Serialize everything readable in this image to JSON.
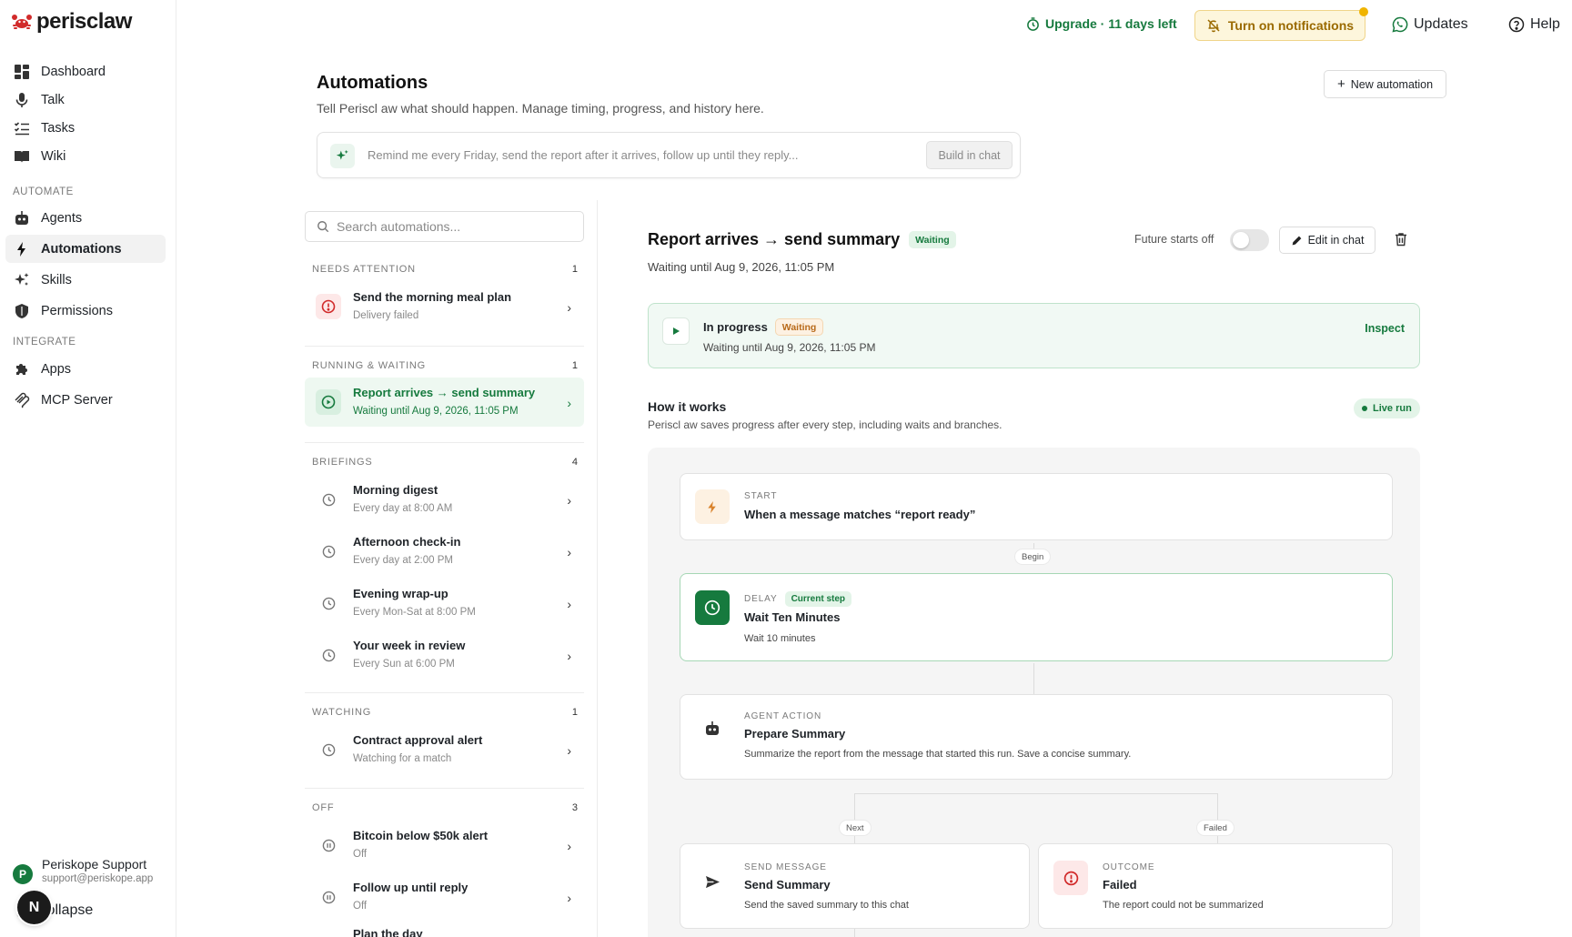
{
  "app": {
    "name": "periscl",
    "name_accent": "aw"
  },
  "colors": {
    "brand": "#167a3e",
    "warning": "#9a6a00",
    "danger": "#d12a2a"
  },
  "sidebar": {
    "nav": [
      {
        "label": "Dashboard",
        "icon": "dashboard-icon"
      },
      {
        "label": "Talk",
        "icon": "microphone-icon"
      },
      {
        "label": "Tasks",
        "icon": "checklist-icon"
      },
      {
        "label": "Wiki",
        "icon": "book-icon"
      }
    ],
    "section_automate": "AUTOMATE",
    "automate": [
      {
        "label": "Agents",
        "icon": "robot-icon"
      },
      {
        "label": "Automations",
        "icon": "bolt-icon",
        "active": true
      },
      {
        "label": "Skills",
        "icon": "sparkles-icon"
      },
      {
        "label": "Permissions",
        "icon": "shield-icon"
      }
    ],
    "section_integrate": "INTEGRATE",
    "integrate": [
      {
        "label": "Apps",
        "icon": "puzzle-icon"
      },
      {
        "label": "MCP Server",
        "icon": "mcp-icon"
      }
    ],
    "user": {
      "initial": "P",
      "name": "Periskope Support",
      "email": "support@periskope.app"
    },
    "collapse_label": "Collapse",
    "floating_badge": "N"
  },
  "topbar": {
    "upgrade": "Upgrade · 11 days left",
    "notifications": "Turn on notifications",
    "updates": "Updates",
    "help": "Help"
  },
  "header": {
    "title": "Automations",
    "subtitle": "Tell Periscl aw what should happen. Manage timing, progress, and history here.",
    "new_button": "New automation",
    "prompt_placeholder": "Remind me every Friday, send the report after it arrives, follow up until they reply...",
    "prompt_button": "Build in chat"
  },
  "list": {
    "search_placeholder": "Search automations...",
    "groups": {
      "attention": {
        "label": "NEEDS ATTENTION",
        "count": "1"
      },
      "running": {
        "label": "RUNNING & WAITING",
        "count": "1"
      },
      "briefings": {
        "label": "BRIEFINGS",
        "count": "4"
      },
      "watching": {
        "label": "WATCHING",
        "count": "1"
      },
      "off": {
        "label": "OFF",
        "count": "3"
      }
    },
    "rows": {
      "meal_plan": {
        "title": "Send the morning meal plan",
        "sub": "Delivery failed"
      },
      "report": {
        "title": "Report arrives → send summary",
        "sub": "Waiting until Aug 9, 2026, 11:05 PM"
      },
      "morning": {
        "title": "Morning digest",
        "sub": "Every day at 8:00 AM"
      },
      "afternoon": {
        "title": "Afternoon check-in",
        "sub": "Every day at 2:00 PM"
      },
      "evening": {
        "title": "Evening wrap-up",
        "sub": "Every Mon-Sat at 8:00 PM"
      },
      "week": {
        "title": "Your week in review",
        "sub": "Every Sun at 6:00 PM"
      },
      "contract": {
        "title": "Contract approval alert",
        "sub": "Watching for a match"
      },
      "bitcoin": {
        "title": "Bitcoin below $50k alert",
        "sub": "Off"
      },
      "follow": {
        "title": "Follow up until reply",
        "sub": "Off"
      },
      "plan": {
        "title": "Plan the day",
        "sub": ""
      }
    }
  },
  "detail": {
    "title": "Report arrives → send summary",
    "status": "Waiting",
    "subtitle": "Waiting until Aug 9, 2026, 11:05 PM",
    "future_label": "Future starts off",
    "future_on": false,
    "edit_button": "Edit in chat",
    "progress": {
      "title": "In progress",
      "status": "Waiting",
      "sub": "Waiting until Aug 9, 2026, 11:05 PM",
      "inspect": "Inspect"
    },
    "how_title": "How it works",
    "how_sub": "Periscl aw saves progress after every step, including waits and branches.",
    "live_run": "Live run",
    "flow": {
      "start": {
        "kind": "START",
        "title": "When a message matches “report ready”"
      },
      "begin_label": "Begin",
      "delay": {
        "kind": "DELAY",
        "badge": "Current step",
        "title": "Wait Ten Minutes",
        "desc": "Wait 10 minutes"
      },
      "agent": {
        "kind": "AGENT ACTION",
        "title": "Prepare Summary",
        "desc": "Summarize the report from the message that started this run. Save a concise summary."
      },
      "next_label": "Next",
      "failed_label": "Failed",
      "send": {
        "kind": "SEND MESSAGE",
        "title": "Send Summary",
        "desc": "Send the saved summary to this chat"
      },
      "outcome": {
        "kind": "OUTCOME",
        "title": "Failed",
        "desc": "The report could not be summarized"
      }
    }
  }
}
